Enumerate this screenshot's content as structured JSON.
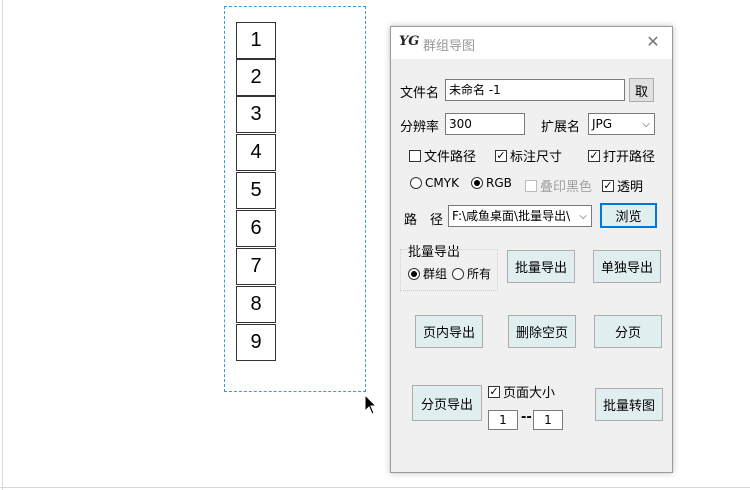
{
  "canvas": {
    "numbers": [
      "1",
      "2",
      "3",
      "4",
      "5",
      "6",
      "7",
      "8",
      "9"
    ]
  },
  "dialog": {
    "logo": "YG",
    "title": "群组导图",
    "close_glyph": "✕",
    "filename_label": "文件名",
    "filename_value": "未命名 -1",
    "fetch_button": "取",
    "resolution_label": "分辨率",
    "resolution_value": "300",
    "extension_label": "扩展名",
    "extension_value": "JPG",
    "file_path_check": "文件路径",
    "mark_size_check": "标注尺寸",
    "open_path_check": "打开路径",
    "cmyk_radio": "CMYK",
    "rgb_radio": "RGB",
    "overprint_check": "叠印黑色",
    "transparent_check": "透明",
    "path_label": "路　径",
    "path_value": "F:\\咸鱼桌面\\批量导出\\",
    "browse_button": "浏览",
    "batch_group_label": "批量导出",
    "group_radio": "群组",
    "all_radio": "所有",
    "batch_export_button": "批量导出",
    "single_export_button": "单独导出",
    "in_page_export_button": "页内导出",
    "delete_blank_button": "删除空页",
    "paginate_button": "分页",
    "page_export_button": "分页导出",
    "page_size_check": "页面大小",
    "range_from": "1",
    "range_sep": "--",
    "range_to": "1",
    "batch_convert_button": "批量转图"
  }
}
